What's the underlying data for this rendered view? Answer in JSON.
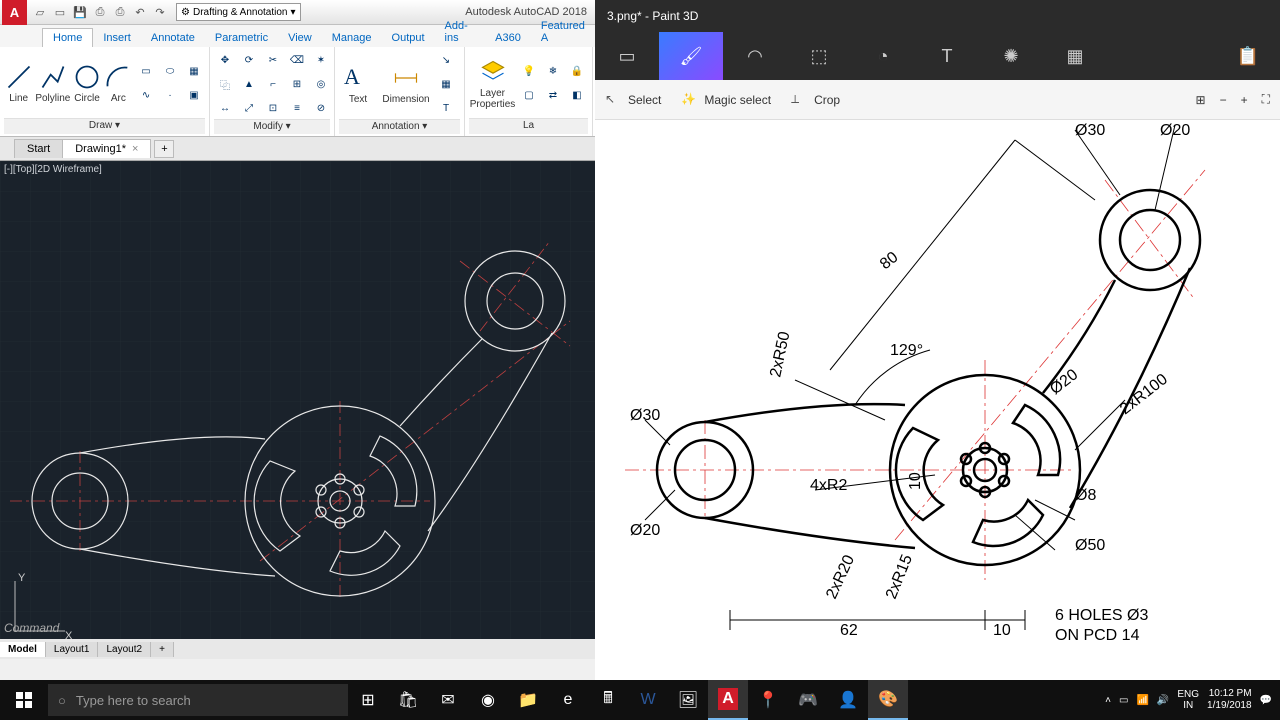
{
  "autocad": {
    "app_title": "Autodesk AutoCAD 2018",
    "workspace": "Drafting & Annotation",
    "ribbon_tabs": [
      "Home",
      "Insert",
      "Annotate",
      "Parametric",
      "View",
      "Manage",
      "Output",
      "Add-ins",
      "A360",
      "Featured A"
    ],
    "active_tab": "Home",
    "panels": {
      "draw": "Draw ▾",
      "modify": "Modify ▾",
      "annotation": "Annotation ▾",
      "layers": "La"
    },
    "tools": {
      "line": "Line",
      "polyline": "Polyline",
      "circle": "Circle",
      "arc": "Arc",
      "text": "Text",
      "dimension": "Dimension",
      "layerprops": "Layer\nProperties"
    },
    "file_tabs": {
      "start": "Start",
      "drawing": "Drawing1*"
    },
    "viewport_label": "[-][Top][2D Wireframe]",
    "command_prompt": "Command",
    "ucs": {
      "x": "X",
      "y": "Y"
    },
    "layout_tabs": [
      "Model",
      "Layout1",
      "Layout2"
    ]
  },
  "paint3d": {
    "title": "3.png* - Paint 3D",
    "tools": [
      "marquee",
      "brush",
      "2d",
      "3d",
      "sticker",
      "text",
      "effects",
      "canvas"
    ],
    "subtools": {
      "select": "Select",
      "magic": "Magic select",
      "crop": "Crop"
    },
    "drawing_labels": {
      "d30a": "Ø30",
      "d20a": "Ø20",
      "len80": "80",
      "ang129": "129°",
      "r50": "2xR50",
      "d30b": "Ø30",
      "d20b": "Ø20",
      "r2": "4xR2",
      "ten": "10",
      "d20c": "Ø20",
      "r100": "2xR100",
      "d8": "Ø8",
      "d50": "Ø50",
      "r20": "2xR20",
      "r15": "2xR15",
      "len62": "62",
      "len10": "10",
      "holes1": "6 HOLES Ø3",
      "holes2": "ON PCD 14"
    }
  },
  "taskbar": {
    "search_placeholder": "Type here to search",
    "lang1": "ENG",
    "lang2": "IN",
    "time": "10:12 PM",
    "date": "1/19/2018"
  }
}
